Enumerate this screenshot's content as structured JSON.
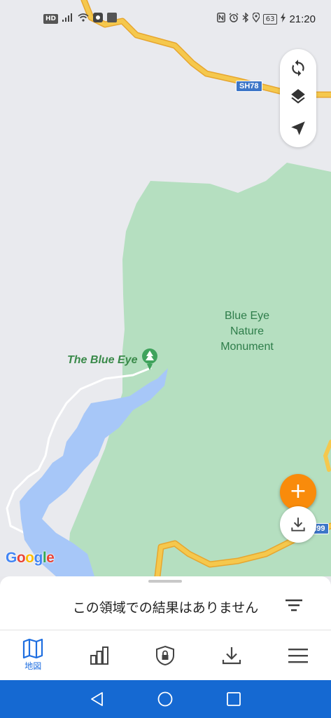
{
  "status_bar": {
    "hd_chip": "HD",
    "battery": "63",
    "time": "21:20",
    "icons": [
      "hd-icon",
      "signal-icon",
      "wifi-icon",
      "app-notification-icon",
      "nfc-icon",
      "alarm-icon",
      "bluetooth-icon",
      "location-icon",
      "battery-icon",
      "charging-icon"
    ]
  },
  "map": {
    "poi_label": "The Blue Eye",
    "area_label": "Blue Eye Nature Monument",
    "road_shields": [
      "SH78",
      "SH99"
    ],
    "attribution": "Google",
    "colors": {
      "park": "#b5dfc0",
      "water": "#a7c7f8",
      "road": "#f5c84d",
      "road_edge": "#e7a62f",
      "background": "#e9eaee"
    }
  },
  "map_controls": [
    "sync-icon",
    "layers-icon",
    "navigation-icon"
  ],
  "fab": {
    "add_symbol": "+",
    "add_color": "#f98b0b"
  },
  "sheet": {
    "message": "この領域での結果はありません"
  },
  "bottom_nav": {
    "items": [
      {
        "label": "地図",
        "icon": "map-icon",
        "active": true
      },
      {
        "label": "",
        "icon": "stats-icon",
        "active": false
      },
      {
        "label": "",
        "icon": "shield-lock-icon",
        "active": false
      },
      {
        "label": "",
        "icon": "download-icon",
        "active": false
      },
      {
        "label": "",
        "icon": "menu-icon",
        "active": false
      }
    ],
    "active_color": "#1e6ee0"
  },
  "system_nav": [
    "back-icon",
    "home-icon",
    "recents-icon"
  ]
}
